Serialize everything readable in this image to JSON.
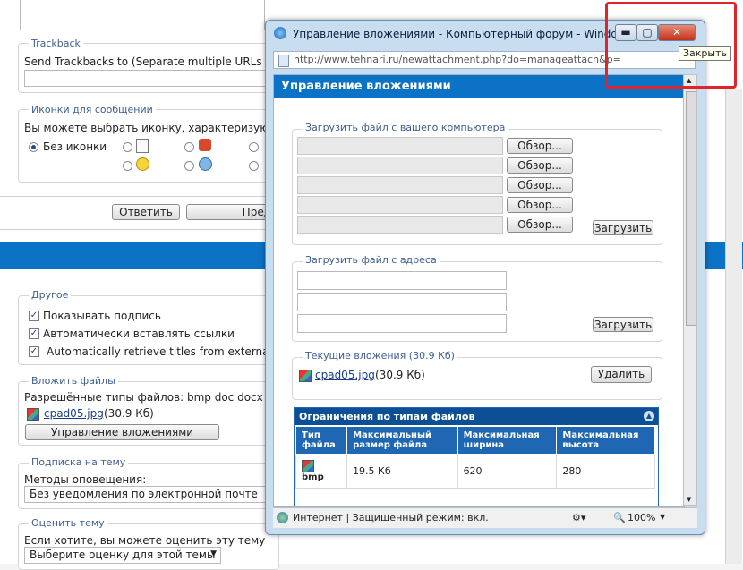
{
  "bg": {
    "trackback_legend": "Trackback",
    "trackback_text": "Send Trackbacks to (Separate multiple URLs w",
    "icons_legend": "Иконки для сообщений",
    "icons_desc": "Вы можете выбрать иконку, характеризующ",
    "no_icon_label": "Без иконки",
    "reply_button": "Ответить",
    "preview_button": "Пред",
    "other_legend": "Другое",
    "show_signature": "Показывать подпись",
    "auto_links": "Автоматически вставлять ссылки",
    "auto_titles": "Automatically retrieve titles from external l",
    "attach_legend": "Вложить файлы",
    "allowed_types": "Разрешённые типы файлов: bmp doc docx gif",
    "file_link": "cpad05.jpg",
    "file_size": "(30.9 Кб)",
    "manage_button": "Управление вложениями",
    "subscribe_legend": "Подписка на тему",
    "notify_label": "Методы оповещения:",
    "notify_value": "Без уведомления по электронной почте",
    "rate_legend": "Оценить тему",
    "rate_desc": "Если хотите, вы можете оценить эту тему",
    "rate_select": "Выберите оценку для этой темы"
  },
  "popup": {
    "title": "Управление вложениями - Компьютерный форум - Windows I",
    "url": "http://www.tehnari.ru/newattachment.php?do=manageattach&p=",
    "header": "Управление вложениями",
    "upload_computer_legend": "Загрузить файл с вашего компьютера",
    "browse_label": "Обзор...",
    "upload_button": "Загрузить",
    "upload_url_legend": "Загрузить файл с адреса",
    "current_legend": "Текущие вложения (30.9 Кб)",
    "current_file": "cpad05.jpg",
    "current_size": "(30.9 Кб)",
    "delete_button": "Удалить",
    "limits_title": "Ограничения по типам файлов",
    "limits_headers": [
      "Тип файла",
      "Максимальный размер файла",
      "Максимальная ширина",
      "Максимальная высота"
    ],
    "limits_rows": [
      {
        "type": "bmp",
        "size": "19.5 Кб",
        "width": "620",
        "height": "280"
      }
    ],
    "status_text": "Интернет | Защищенный режим: вкл.",
    "zoom": "100%",
    "close_tooltip": "Закрыть"
  },
  "colors": {
    "accent": "#0b72c6",
    "highlight": "#e0242b"
  }
}
